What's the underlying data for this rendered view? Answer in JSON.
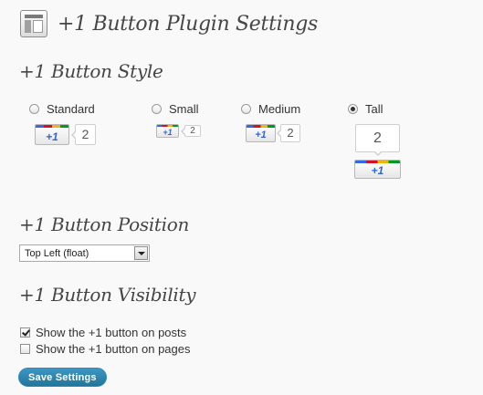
{
  "header": {
    "icon": "settings-page-icon",
    "title": "+1 Button Plugin Settings"
  },
  "style_section": {
    "title": "+1 Button Style",
    "options": [
      {
        "label": "Standard",
        "selected": false,
        "plus": "+1",
        "count": "2"
      },
      {
        "label": "Small",
        "selected": false,
        "plus": "+1",
        "count": "2"
      },
      {
        "label": "Medium",
        "selected": false,
        "plus": "+1",
        "count": "2"
      },
      {
        "label": "Tall",
        "selected": true,
        "plus": "+1",
        "count": "2"
      }
    ]
  },
  "position_section": {
    "title": "+1 Button Position",
    "select_value": "Top Left (float)"
  },
  "visibility_section": {
    "title": "+1 Button Visibility",
    "checkboxes": [
      {
        "label": "Show the +1 button on posts",
        "checked": true
      },
      {
        "label": "Show the +1 button on pages",
        "checked": false
      }
    ]
  },
  "actions": {
    "save_label": "Save Settings"
  },
  "colors": {
    "save_button": "#21759b",
    "google_blue": "#3369e8",
    "google_red": "#d50f25",
    "google_yellow": "#eeb211",
    "google_green": "#009925"
  }
}
